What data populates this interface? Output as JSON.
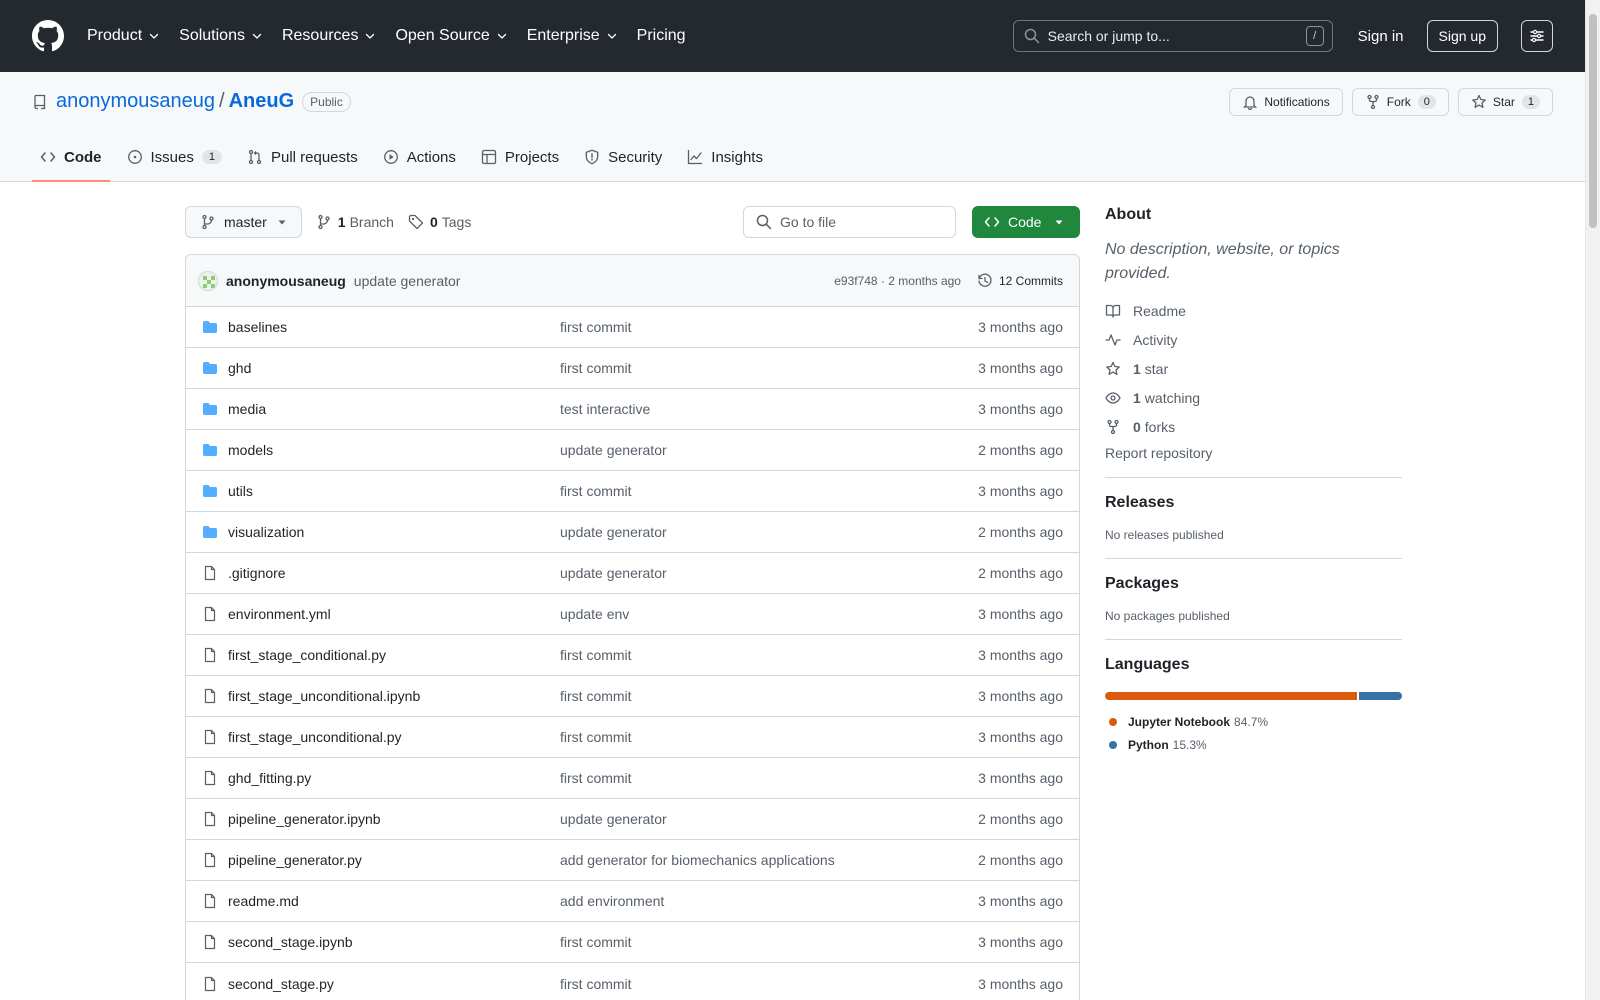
{
  "header": {
    "nav": [
      "Product",
      "Solutions",
      "Resources",
      "Open Source",
      "Enterprise",
      "Pricing"
    ],
    "search_placeholder": "Search or jump to...",
    "search_key": "/",
    "sign_in": "Sign in",
    "sign_up": "Sign up"
  },
  "repo": {
    "owner": "anonymousaneug",
    "separator": "/",
    "name": "AneuG",
    "visibility": "Public",
    "notifications_label": "Notifications",
    "fork_label": "Fork",
    "fork_count": "0",
    "star_label": "Star",
    "star_count": "1"
  },
  "tabs": [
    {
      "label": "Code",
      "icon": "code-icon",
      "active": true
    },
    {
      "label": "Issues",
      "icon": "issue-icon",
      "count": "1"
    },
    {
      "label": "Pull requests",
      "icon": "pull-request-icon"
    },
    {
      "label": "Actions",
      "icon": "play-icon"
    },
    {
      "label": "Projects",
      "icon": "table-icon"
    },
    {
      "label": "Security",
      "icon": "shield-icon"
    },
    {
      "label": "Insights",
      "icon": "graph-icon"
    }
  ],
  "toolbar": {
    "branch": "master",
    "branch_count": "1",
    "branch_label": "Branch",
    "tag_count": "0",
    "tag_label": "Tags",
    "goto_placeholder": "Go to file",
    "code_button": "Code"
  },
  "commit": {
    "author": "anonymousaneug",
    "message": "update generator",
    "meta": "e93f748 · 2 months ago",
    "commits_label": "12 Commits"
  },
  "files": [
    {
      "type": "dir",
      "name": "baselines",
      "message": "first commit",
      "time": "3 months ago"
    },
    {
      "type": "dir",
      "name": "ghd",
      "message": "first commit",
      "time": "3 months ago"
    },
    {
      "type": "dir",
      "name": "media",
      "message": "test interactive",
      "time": "3 months ago"
    },
    {
      "type": "dir",
      "name": "models",
      "message": "update generator",
      "time": "2 months ago"
    },
    {
      "type": "dir",
      "name": "utils",
      "message": "first commit",
      "time": "3 months ago"
    },
    {
      "type": "dir",
      "name": "visualization",
      "message": "update generator",
      "time": "2 months ago"
    },
    {
      "type": "file",
      "name": ".gitignore",
      "message": "update generator",
      "time": "2 months ago"
    },
    {
      "type": "file",
      "name": "environment.yml",
      "message": "update env",
      "time": "3 months ago"
    },
    {
      "type": "file",
      "name": "first_stage_conditional.py",
      "message": "first commit",
      "time": "3 months ago"
    },
    {
      "type": "file",
      "name": "first_stage_unconditional.ipynb",
      "message": "first commit",
      "time": "3 months ago"
    },
    {
      "type": "file",
      "name": "first_stage_unconditional.py",
      "message": "first commit",
      "time": "3 months ago"
    },
    {
      "type": "file",
      "name": "ghd_fitting.py",
      "message": "first commit",
      "time": "3 months ago"
    },
    {
      "type": "file",
      "name": "pipeline_generator.ipynb",
      "message": "update generator",
      "time": "2 months ago"
    },
    {
      "type": "file",
      "name": "pipeline_generator.py",
      "message": "add generator for biomechanics applications",
      "time": "2 months ago"
    },
    {
      "type": "file",
      "name": "readme.md",
      "message": "add environment",
      "time": "3 months ago"
    },
    {
      "type": "file",
      "name": "second_stage.ipynb",
      "message": "first commit",
      "time": "3 months ago"
    },
    {
      "type": "file",
      "name": "second_stage.py",
      "message": "first commit",
      "time": "3 months ago"
    }
  ],
  "sidebar": {
    "about_title": "About",
    "about_desc": "No description, website, or topics provided.",
    "links": [
      {
        "icon": "book-icon",
        "bold": "",
        "label": "Readme"
      },
      {
        "icon": "pulse-icon",
        "bold": "",
        "label": "Activity"
      },
      {
        "icon": "star-icon",
        "bold": "1",
        "label": "star"
      },
      {
        "icon": "eye-icon",
        "bold": "1",
        "label": "watching"
      },
      {
        "icon": "fork-icon",
        "bold": "0",
        "label": "forks"
      }
    ],
    "report": "Report repository",
    "releases_title": "Releases",
    "releases_note": "No releases published",
    "packages_title": "Packages",
    "packages_note": "No packages published",
    "languages_title": "Languages",
    "languages": [
      {
        "name": "Jupyter Notebook",
        "percent": "84.7%",
        "share": 84.7,
        "color": "#DA5B0B"
      },
      {
        "name": "Python",
        "percent": "15.3%",
        "share": 15.3,
        "color": "#3572A5"
      }
    ]
  },
  "colors": {
    "header_bg": "#24292f",
    "link": "#0969da",
    "code_button": "#1f883d",
    "active_tab_underline": "#fd8c73",
    "folder": "#54aeff"
  }
}
